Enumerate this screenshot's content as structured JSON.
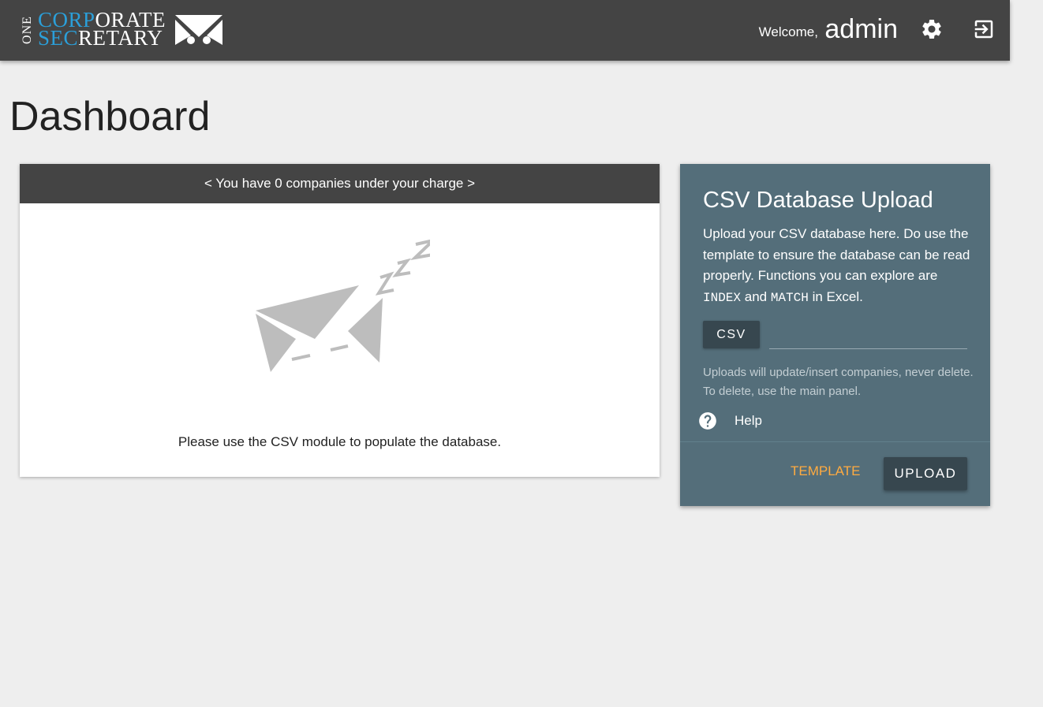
{
  "header": {
    "logo": {
      "one": "ONE",
      "line1_blue": "CORP",
      "line1_white": "ORATE",
      "line2_blue": "SEC",
      "line2_white": "RETARY"
    },
    "welcome_label": "Welcome,",
    "username": "admin",
    "icons": {
      "settings": "gear-icon",
      "logout": "logout-icon"
    }
  },
  "page": {
    "title": "Dashboard"
  },
  "companies": {
    "header": "< You have 0 companies under your charge >",
    "empty_message": "Please use the CSV module to populate the database.",
    "illustration": "sleeping-paper-plane-icon"
  },
  "csv": {
    "title": "CSV Database Upload",
    "description_part1": "Upload your CSV database here. Do use the template to ensure the database can be read properly. Functions you can explore are ",
    "function_index": "INDEX",
    "description_and": " and ",
    "function_match": "MATCH",
    "description_end": " in Excel.",
    "file_button": "CSV",
    "file_path_value": "",
    "note": "Uploads will update/insert companies, never delete. To delete, use the main panel.",
    "help_label": "Help",
    "template_label": "TEMPLATE",
    "upload_label": "UPLOAD"
  },
  "colors": {
    "header_bg": "#444444",
    "page_bg": "#eeeeee",
    "csv_card_bg": "#546e7a",
    "button_bg": "#37474f",
    "accent_orange": "#ffab40",
    "logo_blue": "#2b9fd9"
  }
}
